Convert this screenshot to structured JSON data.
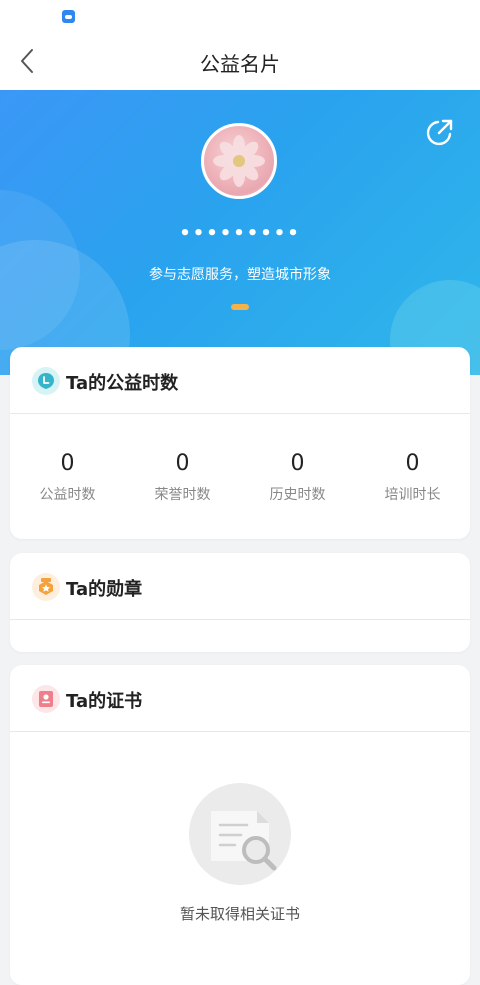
{
  "nav": {
    "title": "公益名片"
  },
  "profile": {
    "name": "•••••••••",
    "slogan": "参与志愿服务，塑造城市形象"
  },
  "hours_card": {
    "title": "Ta的公益时数",
    "stats": [
      {
        "value": "0",
        "label": "公益时数"
      },
      {
        "value": "0",
        "label": "荣誉时数"
      },
      {
        "value": "0",
        "label": "历史时数"
      },
      {
        "value": "0",
        "label": "培训时长"
      }
    ]
  },
  "medal_card": {
    "title": "Ta的勋章"
  },
  "cert_card": {
    "title": "Ta的证书",
    "empty_text": "暂未取得相关证书"
  },
  "icons": {
    "back": "chevron-left-icon",
    "share": "share-icon",
    "hours": "clock-icon",
    "medal": "medal-icon",
    "cert": "certificate-icon"
  },
  "colors": {
    "hero_start": "#3b97f6",
    "hero_end": "#2fb7ea",
    "indicator": "#f4b34a",
    "hours_icon": "#34b5c9",
    "medal_icon": "#f5a13c",
    "cert_icon": "#ef7f8b"
  }
}
